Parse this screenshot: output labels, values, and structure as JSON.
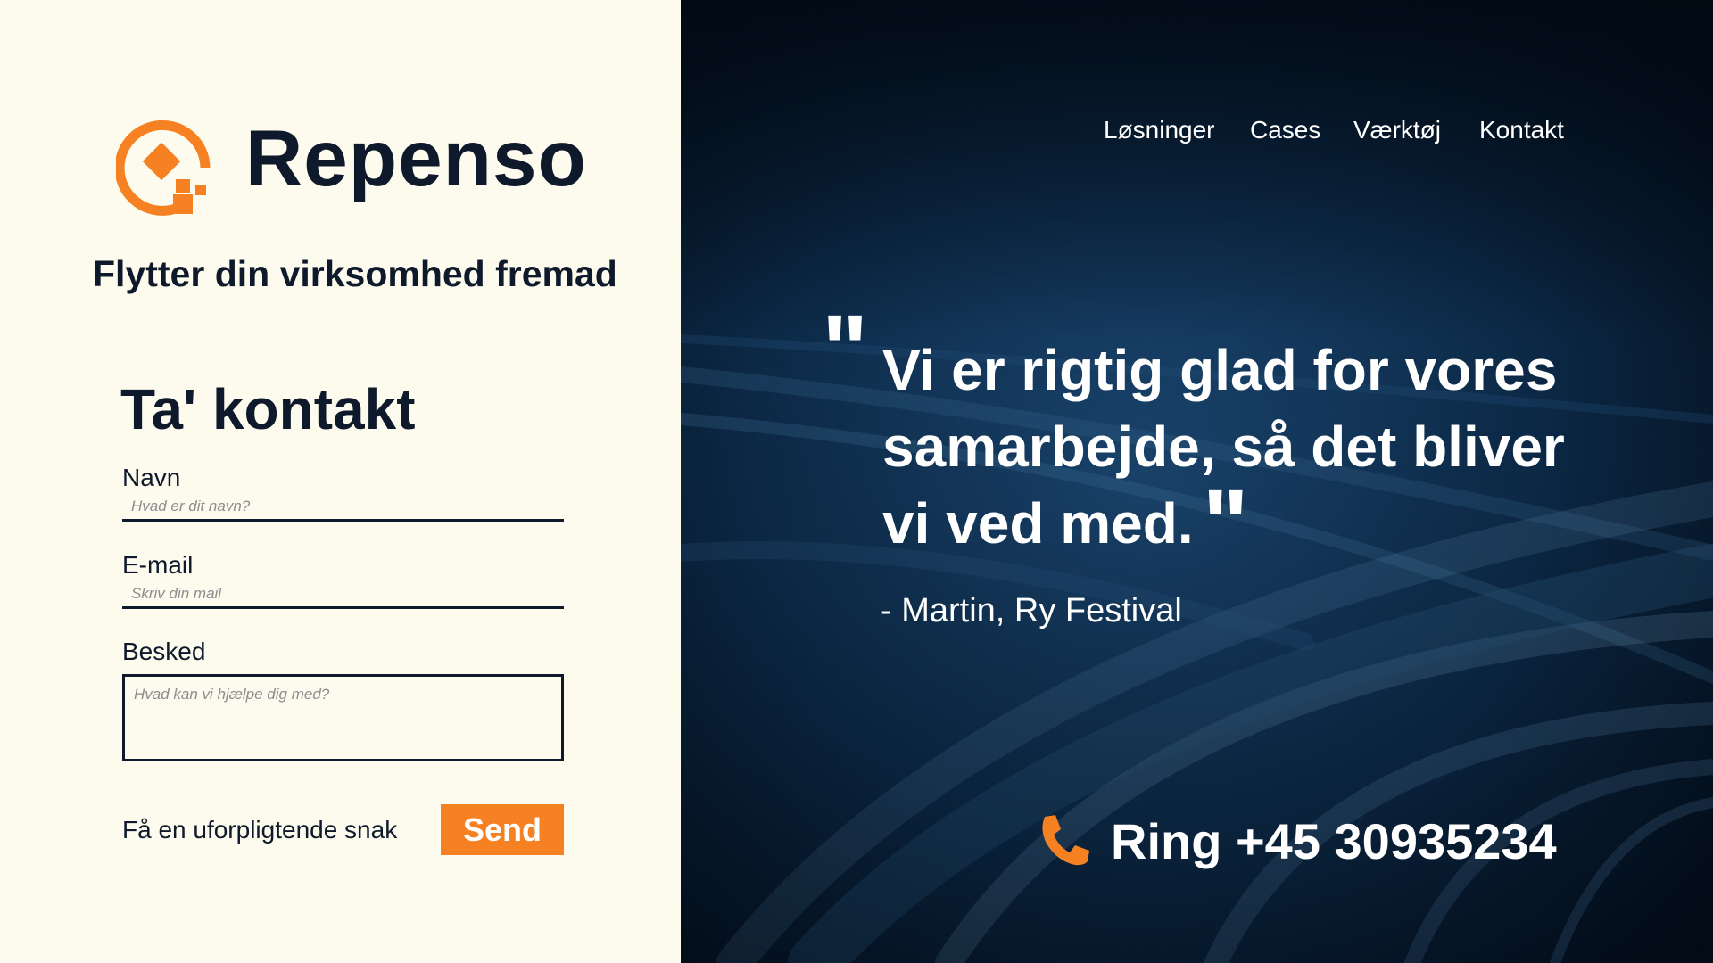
{
  "brand": {
    "name": "Repenso",
    "tagline": "Flytter din virksomhed fremad",
    "accent_color": "#f58123",
    "dark_color": "#0e1a2b",
    "logo_icon": "repenso-logo-icon"
  },
  "contact_form": {
    "title": "Ta' kontakt",
    "name_label": "Navn",
    "name_placeholder": "Hvad er dit navn?",
    "name_value": "",
    "email_label": "E-mail",
    "email_placeholder": "Skriv din mail",
    "email_value": "",
    "message_label": "Besked",
    "message_placeholder": "Hvad kan vi hjælpe dig med?",
    "message_value": "",
    "cta_text": "Få en uforpligtende snak",
    "send_label": "Send"
  },
  "nav": {
    "items": [
      {
        "label": "Løsninger"
      },
      {
        "label": "Cases"
      },
      {
        "label": "Værktøj"
      },
      {
        "label": "Kontakt"
      }
    ]
  },
  "testimonial": {
    "open_quote": "\"",
    "quote": "Vi er rigtig glad for vores samarbejde, så det bliver vi ved med.",
    "close_quote": "\"",
    "author": "- Martin, Ry Festival"
  },
  "phone": {
    "icon": "phone-icon",
    "text": "Ring +45 30935234"
  },
  "colors": {
    "left_background": "#fdfaee",
    "right_background": "#071a2e"
  }
}
